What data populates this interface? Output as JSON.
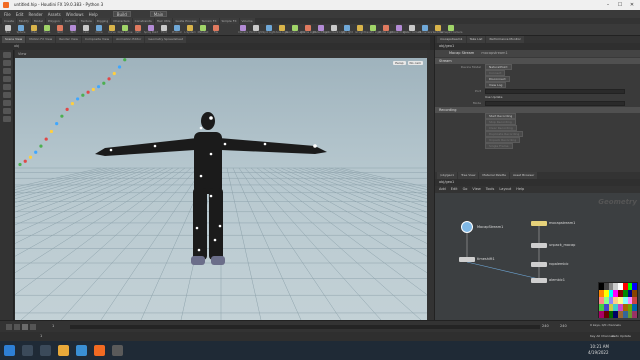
{
  "window": {
    "title": "untitled.hip - Houdini FX 19.0.383 - Python 3"
  },
  "menu": {
    "items": [
      "File",
      "Edit",
      "Render",
      "Assets",
      "Windows",
      "Help"
    ],
    "desktop": "Build",
    "main_label": "Main"
  },
  "shelf_tabs": [
    "Create",
    "Modify",
    "Model",
    "Polygon",
    "Deform",
    "Texture",
    "Rigging",
    "Characters",
    "Constraints",
    "Hair Utils",
    "Guide Process",
    "Terrain FX",
    "Simple FX",
    "Volume"
  ],
  "shelf_tools": [
    "Box",
    "Sphere",
    "Tube",
    "Torus",
    "Grid",
    "Null",
    "Line",
    "Circle",
    "Curve",
    "Draw Curve",
    "Path",
    "Spray Paint",
    "Font",
    "Platonic",
    "L-System",
    "Metaball",
    "File"
  ],
  "light_tools": [
    "Camera",
    "Point Light",
    "Spot Light",
    "Area Light",
    "Geometry Light",
    "Volume Light",
    "Distant Light",
    "Environment Light",
    "Sky Light",
    "GI Light",
    "Caustic Light",
    "Portal Light",
    "Ambient Light",
    "Stereo Camera",
    "VR Camera",
    "Switcher",
    "Gamepad Camera"
  ],
  "view_tabs": [
    "Scene View",
    "Motion FX View",
    "Render View",
    "Composite View",
    "Animation Editor",
    "Geometry Spreadsheet"
  ],
  "path": "obj",
  "viewport": {
    "title": "View",
    "camera": "Persp",
    "cam_menu": "No cam"
  },
  "params": {
    "tabs": [
      "mocapstream1",
      "Take List",
      "Performance Monitor"
    ],
    "path": "obj/geo1",
    "node_title": "Mocap Stream",
    "node_name": "mocapstream1",
    "section1": "Stream",
    "device_label": "Device Model",
    "device_value": "NaturalPoint",
    "btn_connect": "Connect",
    "btn_disconnect": "Disconnect",
    "btn_viewlog": "View Log",
    "port_label": "Port",
    "use_label": "Use Update",
    "mode_label": "Mode",
    "opt_subscription": "Subscription Mode",
    "section2": "Recording",
    "btn_start": "Start Recording",
    "btn_stop": "Stop Recording",
    "btn_clear": "Clear Recording",
    "btn_dupe": "Duplicate Recording",
    "btn_unpack": "Unpack Recording",
    "btn_single": "Single Frame"
  },
  "network": {
    "tabs": [
      "/obj/geo1",
      "Tree View",
      "Material Palette",
      "Asset Browser"
    ],
    "path": "obj/geo1",
    "menu": [
      "Add",
      "Edit",
      "Go",
      "View",
      "Tools",
      "Layout",
      "Help"
    ],
    "context_label": "Geometry",
    "nodes": [
      "MocapStream1",
      "mocapstream1",
      "unpack_mocap",
      "timeshift1",
      "ropalembic",
      "alembic1"
    ]
  },
  "timeline": {
    "frame": "1",
    "start": "1",
    "end": "240",
    "end2": "240"
  },
  "keys": {
    "label": "0 keys, 0/0 channels",
    "auto": "Key All Channels"
  },
  "update": {
    "label": "Auto Update"
  },
  "taskbar": {
    "time": "10:21 AM",
    "date": "4/19/2022"
  },
  "colors": {
    "accent": "#f16a22",
    "viewport_top": "#9fb3bd",
    "viewport_bottom": "#c3d1d6",
    "node_selected": "#e6d27a"
  }
}
